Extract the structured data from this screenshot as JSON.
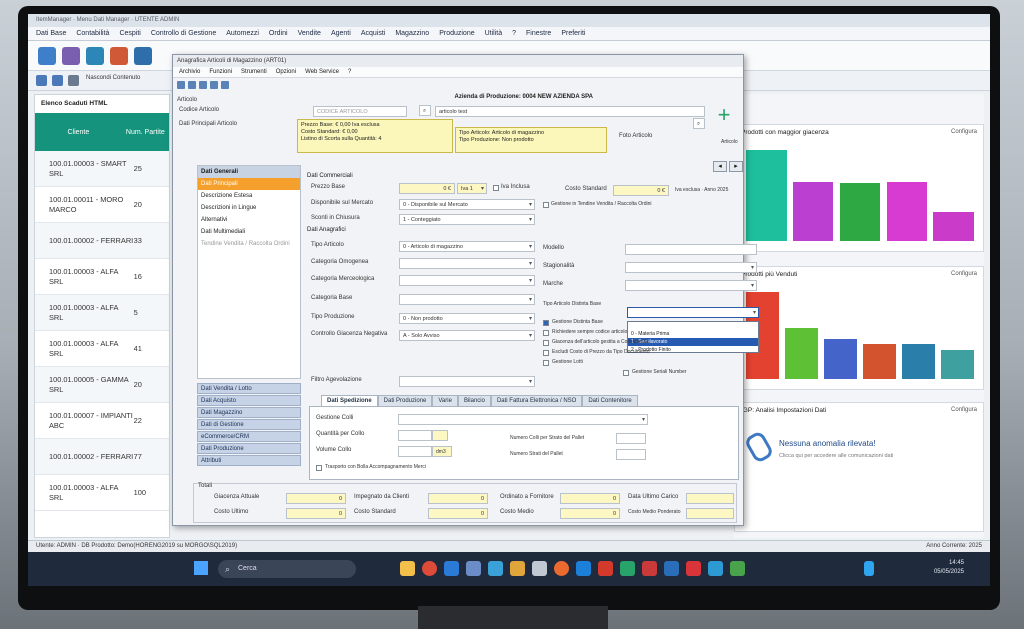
{
  "app": {
    "title": "ItemManager · Menu Dati Manager · UTENTE ADMIN",
    "menu": [
      "Dati Base",
      "Contabilità",
      "Cespiti",
      "Controllo di Gestione",
      "Automezzi",
      "Ordini",
      "Vendite",
      "Agenti",
      "Acquisti",
      "Magazzino",
      "Produzione",
      "Utilità",
      "?",
      "Finestre",
      "Preferiti"
    ],
    "toolbar_note": "Nascondi Contenuto"
  },
  "clients": {
    "title": "Elenco Scaduti HTML",
    "col_client": "Cliente",
    "col_num": "Num. Partite",
    "rows": [
      {
        "name": "100.01.00003 - SMART SRL",
        "num": "25"
      },
      {
        "name": "100.01.00011 - MORO MARCO",
        "num": "20"
      },
      {
        "name": "100.01.00002 - FERRARI",
        "num": "33"
      },
      {
        "name": "100.01.00003 - ALFA SRL",
        "num": "16"
      },
      {
        "name": "100.01.00003 - ALFA SRL",
        "num": "5"
      },
      {
        "name": "100.01.00003 - ALFA SRL",
        "num": "41"
      },
      {
        "name": "100.01.00005 - GAMMA SRL",
        "num": "20"
      },
      {
        "name": "100.01.00007 - IMPIANTI ABC",
        "num": "22"
      },
      {
        "name": "100.01.00002 - FERRARI",
        "num": "77"
      },
      {
        "name": "100.01.00003 - ALFA SRL",
        "num": "100"
      }
    ]
  },
  "dashboard": {
    "panel1_title": "Prodotti con maggior giacenza",
    "panel2_title": "Prodotti più Venduti",
    "panel3_title": "IGP: Analisi Impostazioni Dati",
    "configura": "Configura",
    "nessuna": "Nessuna anomalia rilevata!",
    "nessuna_sub": "Clicca qui per accedere alle comunicazioni dati"
  },
  "chart_data": [
    {
      "type": "bar",
      "title": "Prodotti con maggior giacenza",
      "categories": [
        "",
        "",
        "",
        "",
        ""
      ],
      "values": [
        100,
        65,
        64,
        65,
        32
      ],
      "colors": [
        "#1dbf9c",
        "#bb3fd1",
        "#2ea843",
        "#d83bd1",
        "#c93bc8"
      ],
      "ylim": [
        0,
        110
      ]
    },
    {
      "type": "bar",
      "title": "Prodotti più Venduti",
      "categories": [
        "",
        "",
        "",
        "",
        "",
        ""
      ],
      "values": [
        100,
        58,
        46,
        40,
        40,
        33
      ],
      "colors": [
        "#e34230",
        "#5ec035",
        "#4564c9",
        "#d3532f",
        "#2a7eaa",
        "#3ea1a0"
      ],
      "ylim": [
        0,
        110
      ]
    }
  ],
  "dialog": {
    "title": "Anagrafica Articoli di Magazzino (ART01)",
    "menu": [
      "Archivio",
      "Funzioni",
      "Strumenti",
      "Opzioni",
      "Web Service",
      "?"
    ],
    "azienda": "Azienda di Produzione: 0004 NEW AZIENDA SPA",
    "articolo_label": "Articolo",
    "codice_label": "Codice Articolo",
    "codice_value": "CODICE ARTICOLO",
    "desc_value": "articolo test",
    "principali_label": "Dati Principali Articolo",
    "info_left": "Prezzo Base: € 0,00 Iva esclusa\nCosto Standard: € 0,00\nListino di Scorta sulla Quantità: 4",
    "info_right": "Tipo Articolo: Articolo di magazzino\nTipo Produzione: Non prodotto",
    "foto": "Foto Articolo",
    "nav_head": "Dati Generali",
    "nav_items": [
      "Dati Principali",
      "Descrizione Estesa",
      "Descrizioni in Lingue",
      "Alternativi",
      "Dati Multimediali",
      "Tendine Vendita / Raccolta Ordini"
    ],
    "nav_low": [
      "Dati Vendita / Lotto",
      "Dati Acquisto",
      "Dati Magazzino",
      "Dati di Gestione",
      "eCommerce/CRM",
      "Dati Produzione",
      "Attributi"
    ],
    "commerciali": "Dati Commerciali",
    "prezzo_base": "Prezzo Base",
    "prezzo_val": "0 €",
    "iva": "Iva 1",
    "iva_esclusa": "Iva Inclusa",
    "costo_std": "Costo Standard",
    "costo_val": "0 €",
    "costo_note": "Iva esclusa · Anno 2025",
    "disponibile": "Disponibile sul Mercato",
    "disponibile_val": "0 - Disponibile sul Mercato",
    "gestione_tendine": "Gestione in Tendine Vendita / Raccolta Ordini",
    "sconti": "Sconti in Chiusura",
    "sconti_val": "1 - Conteggiato",
    "anagrafici": "Dati Anagrafici",
    "tipo_art": "Tipo Articolo",
    "tipo_art_val": "0 - Articolo di magazzino",
    "cat_omog": "Categoria Omogenea",
    "cat_merc": "Categoria Merceologica",
    "cat_base": "Categoria Base",
    "tipo_prod": "Tipo Produzione",
    "tipo_prod_val": "0 - Non prodotto",
    "controllo": "Controllo Giacenza Negativa",
    "controllo_val": "A - Solo Avviso",
    "modello": "Modello",
    "stagionalita": "Stagionalità",
    "marche": "Marche",
    "tipo_dist": "Tipo Articolo Distinta Base",
    "dd_options": [
      "",
      "0 - Materia Prima",
      "1 - Semilavorato",
      "2 - Prodotto Finito"
    ],
    "checks": [
      "Gestione Distinta Base",
      "Richiedere sempre codice articolo",
      "Giacenza dell'articolo gestita a Consistenza",
      "Escludi Costo di Prezzo da Tipo Documento",
      "Gestione Lotti",
      "Gestione Seriali Number"
    ],
    "filtro": "Filtro Agevolazione",
    "tabs": [
      "Dati Spedizione",
      "Dati Produzione",
      "Varie",
      "Bilancio",
      "Dati Fattura Elettronica / NSO",
      "Dati Contenitore"
    ],
    "gestione_colli": "Gestione Colli",
    "qta_collo": "Quantità per Collo",
    "volume": "Volume Collo",
    "volume_val": "dm3",
    "num_colli": "Numero Colli per Strato del Pallet",
    "num_strati": "Numero Strati del Pallet",
    "trasporto": "Trasporto con Bolla Accompagnamento Merci",
    "totali": "Totali",
    "giacenza": "Giacenza Attuale",
    "impegnato": "Impegnato da Clienti",
    "ordinato": "Ordinato a Fornitore",
    "data_carico": "Data Ultimo Carico",
    "costo_ultimo": "Costo Ultimo",
    "costo_standard": "Costo Standard",
    "costo_medio": "Costo Medio",
    "costo_ponderato": "Costo Medio Ponderato",
    "zero": "0",
    "plus_label": "Articolo"
  },
  "status": {
    "left": "Utente: ADMIN · DB Prodotto: Demo(HORENG2019 su MORGO\\SQL2019)",
    "right": "Anno Corrente: 2025"
  },
  "taskbar": {
    "search_placeholder": "Cerca",
    "time": "14:45",
    "date": "05/05/2025"
  }
}
